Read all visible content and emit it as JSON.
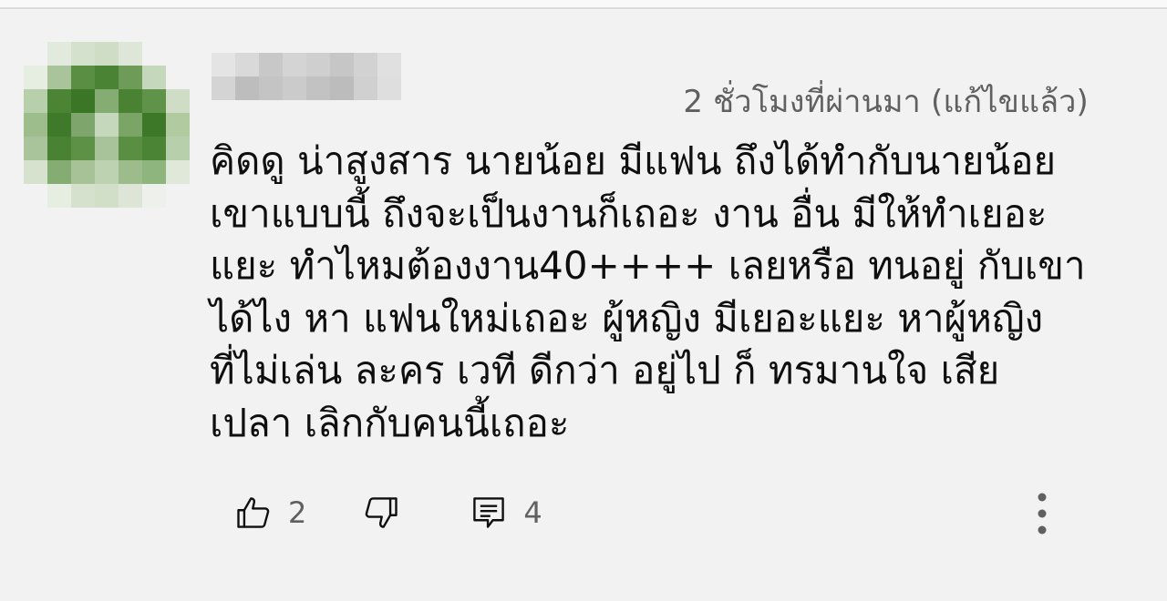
{
  "comment": {
    "timestamp": "2 ชั่วโมงที่ผ่านมา (แก้ไขแล้ว)",
    "text_lines": [
      "คิดดู น่าสูงสาร นายน้อย มีแฟน ถึงได้ทำกับนายน้อย",
      "เขาแบบนี้ ถึงจะเป็นงานก็เถอะ  งาน อื่น มีให้ทำเยอะ",
      "แยะ  ทำไหมต้องงาน40++++ เลยหรือ ทนอยู่ กับเขา",
      "ได้ไง  หา แฟนใหม่เถอะ ผู้หญิง มีเยอะแยะ  หาผู้หญิง",
      "ที่ไม่เล่น  ละคร เวที ดีกว่า อยู่ไป ก็ ทรมานใจ เสีย",
      "เปลา เลิกกับคนนี้เถอะ"
    ]
  },
  "actions": {
    "like_count": "2",
    "reply_count": "4"
  },
  "icons": {
    "avatar": "avatar-pixelated",
    "like": "thumbs-up-icon",
    "dislike": "thumbs-down-icon",
    "reply": "comment-icon",
    "more": "more-vertical-icon"
  },
  "colors": {
    "background": "#f2f2f2",
    "text": "#0f0f0f",
    "secondary_text": "#606060",
    "avatar_green": "#3f7a2a"
  }
}
